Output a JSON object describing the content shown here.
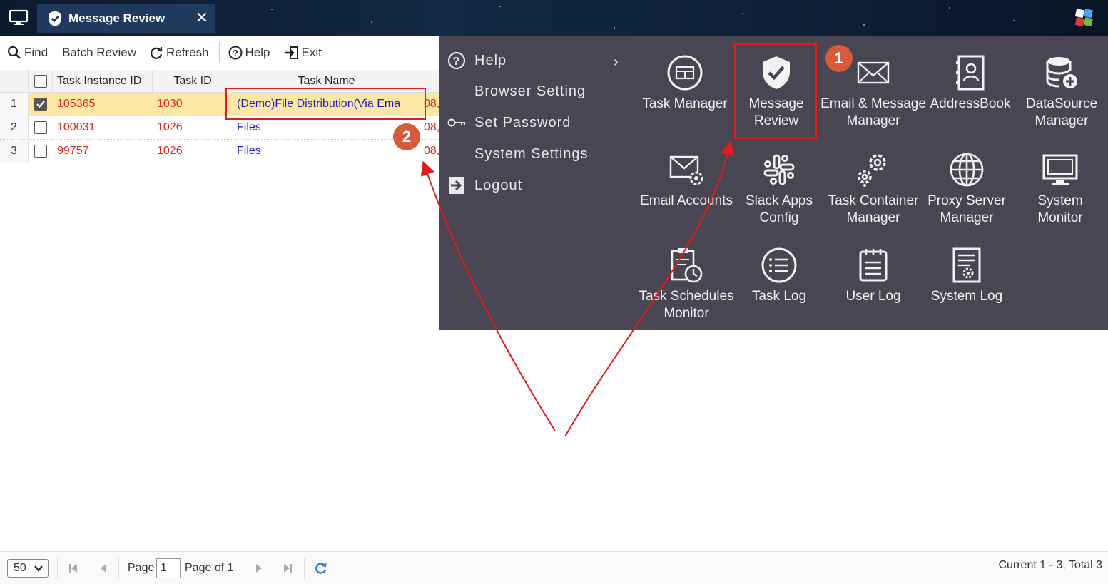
{
  "window": {
    "tab_title": "Message Review",
    "close_glyph": "✕"
  },
  "toolbar": {
    "find": "Find",
    "batch_review": "Batch Review",
    "refresh": "Refresh",
    "help": "Help",
    "exit": "Exit"
  },
  "grid": {
    "columns": [
      "Task Instance ID",
      "Task ID",
      "Task Name"
    ],
    "rows": [
      {
        "num": "1",
        "checked": true,
        "instance_id": "105365",
        "task_id": "1030",
        "task_name": "(Demo)File Distribution(Via Ema",
        "extra": "08,"
      },
      {
        "num": "2",
        "checked": false,
        "instance_id": "100031",
        "task_id": "1026",
        "task_name": "Files",
        "extra": "08,"
      },
      {
        "num": "3",
        "checked": false,
        "instance_id": "99757",
        "task_id": "1026",
        "task_name": "Files",
        "extra": "08,"
      }
    ]
  },
  "menu": {
    "left_items": [
      {
        "label": "Help",
        "icon": "question-circle-icon"
      },
      {
        "label": "Browser Setting",
        "icon": ""
      },
      {
        "label": "Set Password",
        "icon": "key-icon"
      },
      {
        "label": "System Settings",
        "icon": ""
      },
      {
        "label": "Logout",
        "icon": "logout-icon"
      }
    ],
    "apps": [
      {
        "label1": "Task Manager",
        "label2": "",
        "icon": "task-manager-icon"
      },
      {
        "label1": "Message",
        "label2": "Review",
        "icon": "shield-check-icon"
      },
      {
        "label1": "Email & Message",
        "label2": "Manager",
        "icon": "envelope-icon"
      },
      {
        "label1": "AddressBook",
        "label2": "",
        "icon": "addressbook-icon"
      },
      {
        "label1": "DataSource",
        "label2": "Manager",
        "icon": "database-plus-icon"
      },
      {
        "label1": "Email Accounts",
        "label2": "",
        "icon": "envelope-gear-icon"
      },
      {
        "label1": "Slack Apps",
        "label2": "Config",
        "icon": "slack-icon"
      },
      {
        "label1": "Task Container",
        "label2": "Manager",
        "icon": "gears-icon"
      },
      {
        "label1": "Proxy Server",
        "label2": "Manager",
        "icon": "globe-icon"
      },
      {
        "label1": "System",
        "label2": "Monitor",
        "icon": "monitor-icon"
      },
      {
        "label1": "Task Schedules",
        "label2": "Monitor",
        "icon": "clipboard-clock-icon"
      },
      {
        "label1": "Task Log",
        "label2": "",
        "icon": "list-circle-icon"
      },
      {
        "label1": "User Log",
        "label2": "",
        "icon": "notepad-icon"
      },
      {
        "label1": "System Log",
        "label2": "",
        "icon": "doc-gear-icon"
      }
    ]
  },
  "annotations": {
    "badge1": "1",
    "badge2": "2",
    "accent_color": "#e21b1b",
    "badge_color": "#d75a3c"
  },
  "footer": {
    "page_size": "50",
    "page_label": "Page",
    "page_value": "1",
    "page_of": "Page of 1",
    "summary": "Current 1 - 3, Total 3"
  }
}
